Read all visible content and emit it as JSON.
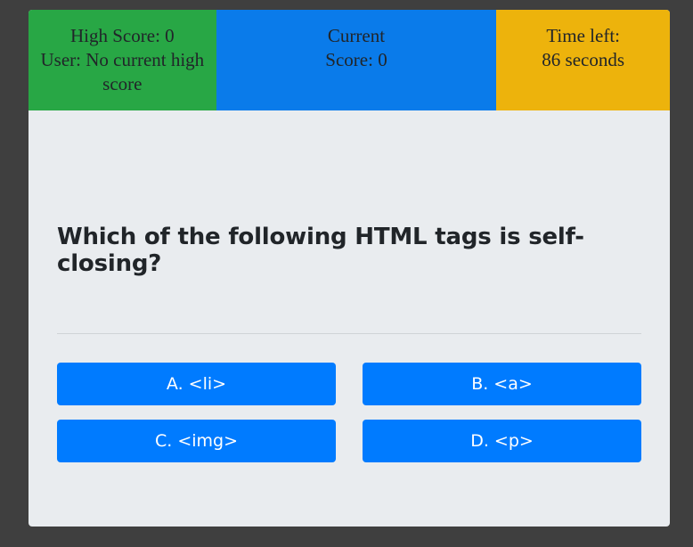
{
  "scoreboard": {
    "high_score_line1": "High Score: 0",
    "high_score_line2": "User: No current high score",
    "current_line1": "Current",
    "current_line2": "Score: 0",
    "time_line1": "Time left:",
    "time_line2": "86 seconds"
  },
  "question": "Which of the following HTML tags is self-closing?",
  "answers": [
    "A. <li>",
    "B. <a>",
    "C. <img>",
    "D. <p>"
  ],
  "colors": {
    "high_score_bg": "#28a745",
    "current_score_bg": "#0a7bea",
    "time_bg": "#edb30c",
    "answer_bg": "#007bff"
  }
}
